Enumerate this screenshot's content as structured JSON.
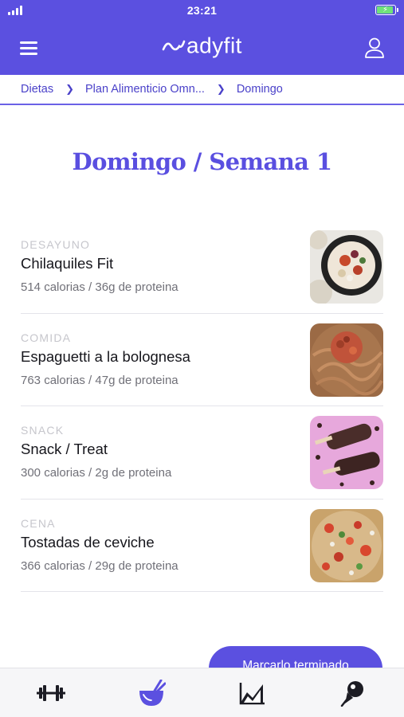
{
  "status_bar": {
    "time": "23:21"
  },
  "header": {
    "logo_text": "adyfit",
    "menu_icon": "hamburger-menu-icon",
    "user_icon": "user-icon"
  },
  "breadcrumb": [
    {
      "label": "Dietas"
    },
    {
      "label": "Plan Alimenticio Omn..."
    },
    {
      "label": "Domingo"
    }
  ],
  "page": {
    "title": "Domingo / Semana 1"
  },
  "meals": [
    {
      "category": "DESAYUNO",
      "name": "Chilaquiles Fit",
      "info": "514 calorias / 36g de proteina",
      "image_icon": "chilaquiles-photo"
    },
    {
      "category": "COMIDA",
      "name": "Espaguetti a la bolognesa",
      "info": "763 calorias / 47g de proteina",
      "image_icon": "spaghetti-photo"
    },
    {
      "category": "SNACK",
      "name": "Snack / Treat",
      "info": "300 calorias / 2g de proteina",
      "image_icon": "chocolate-popsicle-photo"
    },
    {
      "category": "CENA",
      "name": "Tostadas de ceviche",
      "info": "366 calorias / 29g de proteina",
      "image_icon": "ceviche-photo"
    }
  ],
  "cta": {
    "label": "Marcarlo terminado"
  },
  "tabbar": [
    {
      "icon": "dumbbell-icon",
      "active": false
    },
    {
      "icon": "food-bowl-icon",
      "active": true
    },
    {
      "icon": "progress-chart-icon",
      "active": false
    },
    {
      "icon": "pushpin-icon",
      "active": false
    }
  ],
  "colors": {
    "brand": "#5b50e0",
    "title": "#5a4fe0",
    "breadcrumb": "#4a41c9",
    "category": "#c6c6cc"
  }
}
